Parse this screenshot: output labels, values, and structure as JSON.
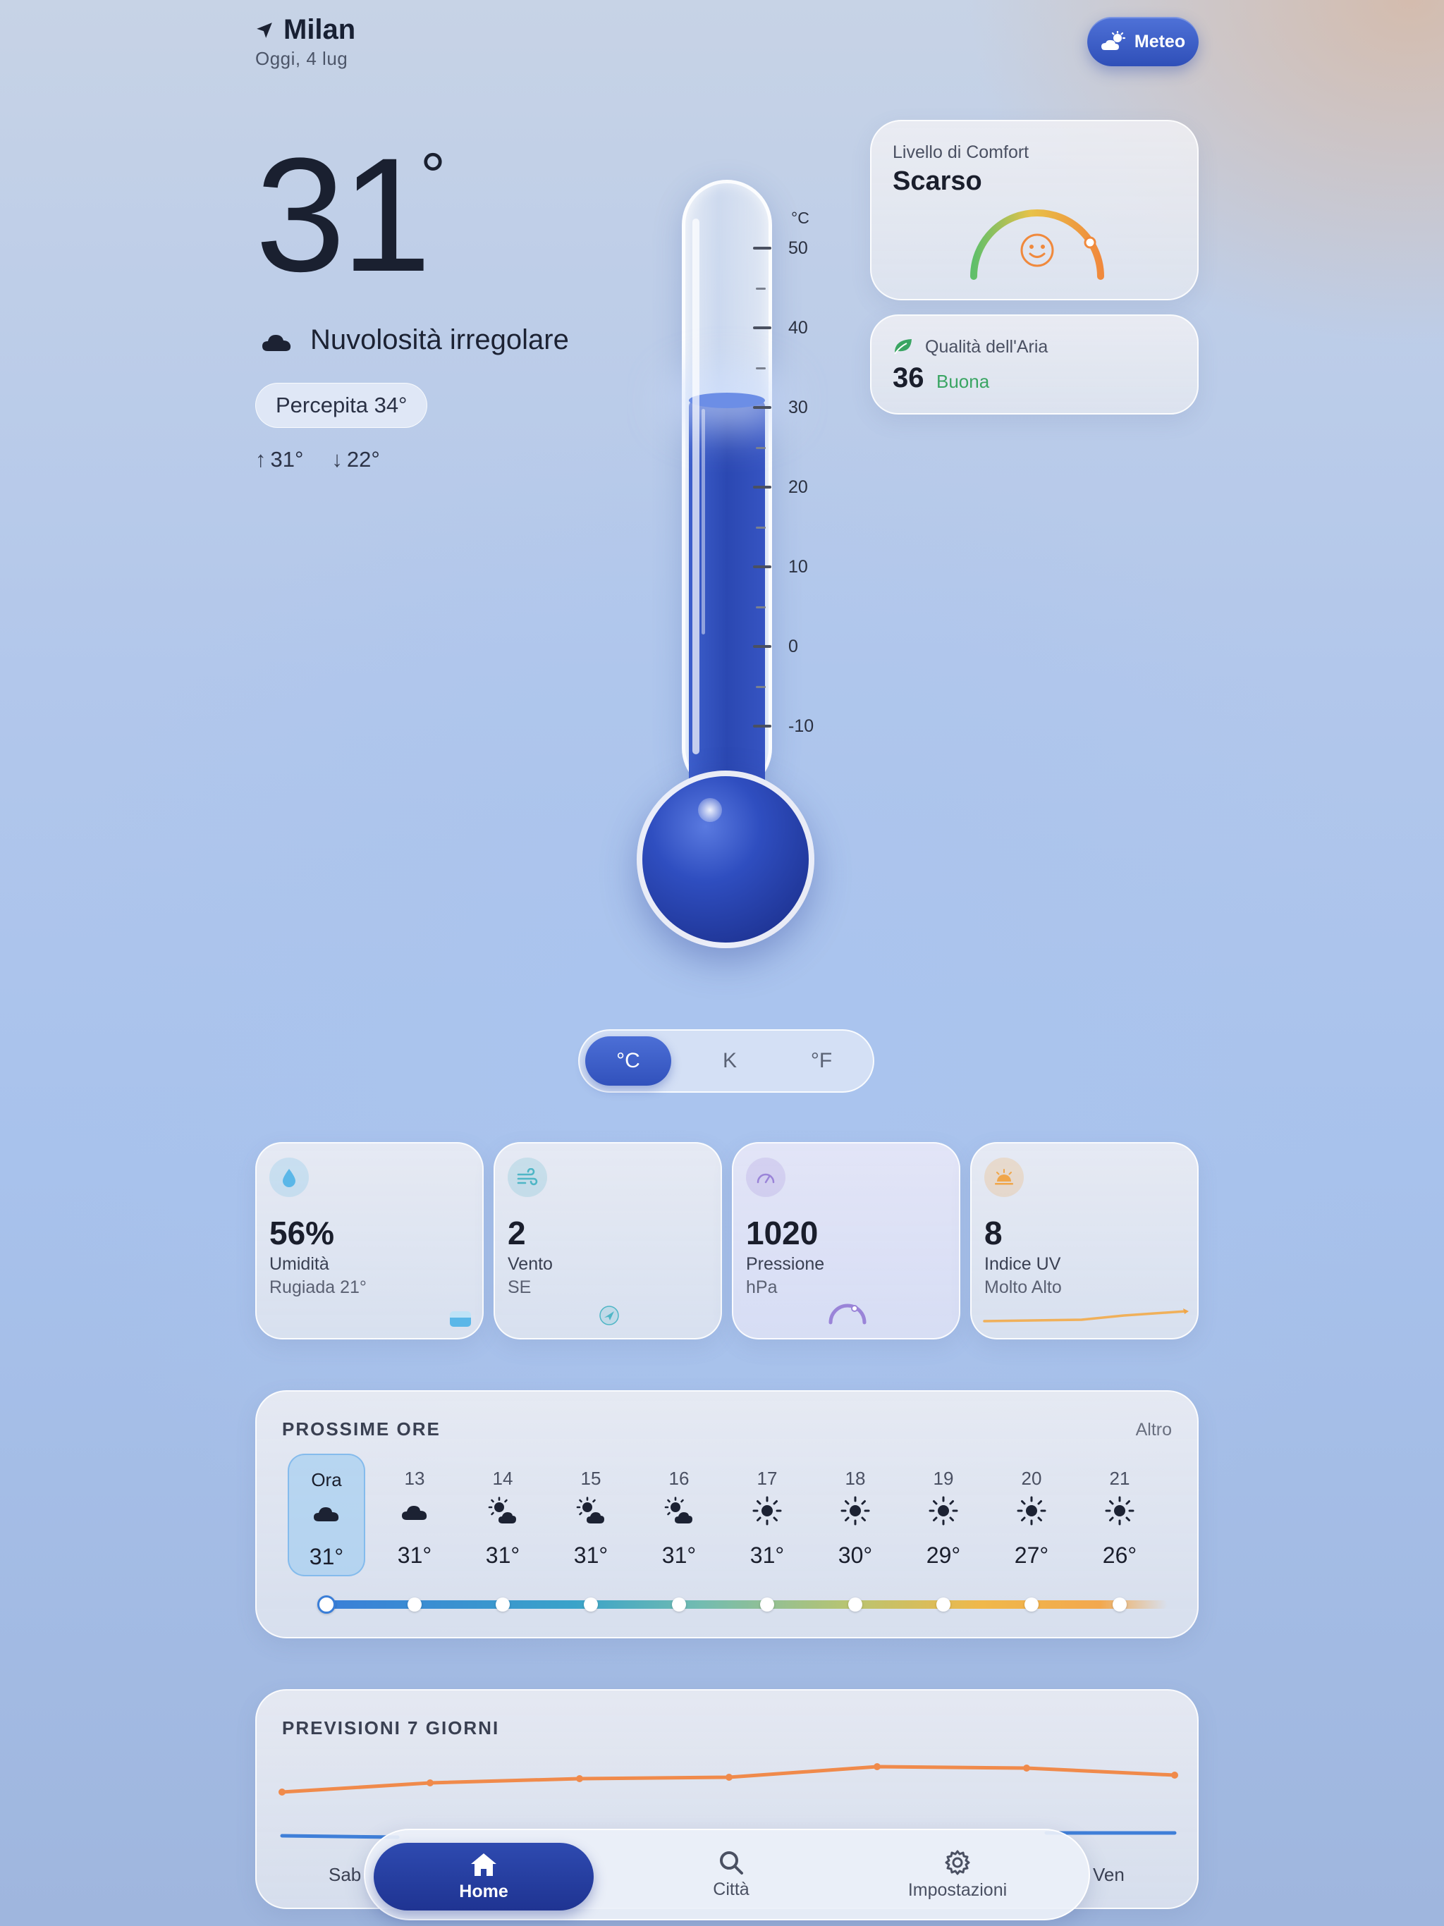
{
  "header": {
    "city": "Milan",
    "date": "Oggi, 4 lug",
    "meteo_button": "Meteo"
  },
  "current": {
    "temp": "31",
    "deg": "°",
    "condition": "Nuvolosità irregolare",
    "feels_like": "Percepita 34°",
    "high": "31°",
    "low": "22°",
    "icons": {
      "location": "location-arrow-icon",
      "condition": "cloud-icon"
    }
  },
  "thermometer": {
    "unit": "°C",
    "scale_labels": [
      "50",
      "40",
      "30",
      "20",
      "10",
      "0",
      "-10"
    ],
    "fill_value_c": 31
  },
  "unit_toggle": {
    "options": [
      "°C",
      "K",
      "°F"
    ],
    "selected": "°C"
  },
  "comfort": {
    "label": "Livello di Comfort",
    "value": "Scarso",
    "level_fraction": 0.82,
    "face_color": "#f0893c"
  },
  "air_quality": {
    "label": "Qualità dell'Aria",
    "value": "36",
    "quality": "Buona",
    "quality_color": "#3aa563"
  },
  "stats": [
    {
      "value": "56%",
      "label": "Umidità",
      "sub": "Rugiada 21°",
      "icon": "droplet-icon",
      "color": "#5bb7e8"
    },
    {
      "value": "2",
      "label": "Vento",
      "sub": "SE",
      "icon": "wind-icon",
      "color": "#4fb6c6"
    },
    {
      "value": "1020",
      "label": "Pressione",
      "sub": "hPa",
      "icon": "gauge-icon",
      "color": "#9a84d8"
    },
    {
      "value": "8",
      "label": "Indice UV",
      "sub": "Molto Alto",
      "icon": "sunrise-icon",
      "color": "#f0a64a"
    }
  ],
  "hourly": {
    "title": "PROSSIME ORE",
    "more": "Altro",
    "hours": [
      {
        "h": "Ora",
        "t": "31°",
        "icon": "cloud-icon"
      },
      {
        "h": "13",
        "t": "31°",
        "icon": "cloud-icon"
      },
      {
        "h": "14",
        "t": "31°",
        "icon": "sun-cloud-icon"
      },
      {
        "h": "15",
        "t": "31°",
        "icon": "sun-cloud-icon"
      },
      {
        "h": "16",
        "t": "31°",
        "icon": "sun-cloud-icon"
      },
      {
        "h": "17",
        "t": "31°",
        "icon": "sun-icon"
      },
      {
        "h": "18",
        "t": "30°",
        "icon": "sun-icon"
      },
      {
        "h": "19",
        "t": "29°",
        "icon": "sun-icon"
      },
      {
        "h": "20",
        "t": "27°",
        "icon": "sun-icon"
      },
      {
        "h": "21",
        "t": "26°",
        "icon": "sun-icon"
      }
    ]
  },
  "weekly": {
    "title": "PREVISIONI 7 GIORNI",
    "first_day": "Sab",
    "last_day": "Ven"
  },
  "tabbar": {
    "tabs": [
      "Home",
      "Città",
      "Impostazioni"
    ],
    "active": "Home"
  }
}
